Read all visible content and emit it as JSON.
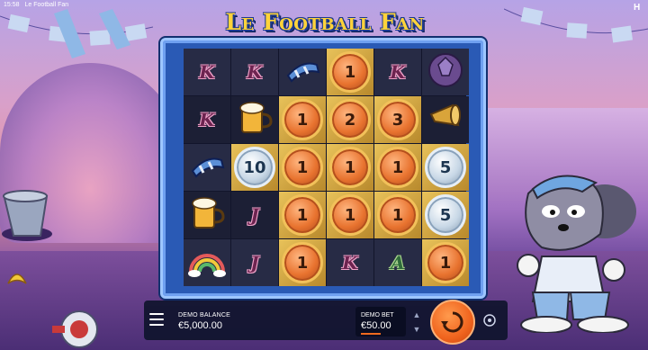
{
  "hud_top": {
    "time": "15:58",
    "title": "Le Football Fan"
  },
  "logo": {
    "text": "Le Football Fan"
  },
  "board": {
    "rows": [
      [
        {
          "type": "letter",
          "value": "K",
          "style": "pink"
        },
        {
          "type": "letter",
          "value": "K",
          "style": "pink"
        },
        {
          "type": "symbol",
          "icon": "scarf-icon"
        },
        {
          "type": "coin",
          "value": "1",
          "metal": "bronze",
          "bg": "gold"
        },
        {
          "type": "letter",
          "value": "K",
          "style": "pink"
        },
        {
          "type": "symbol",
          "icon": "football-icon"
        }
      ],
      [
        {
          "type": "letter",
          "value": "K",
          "style": "pink"
        },
        {
          "type": "symbol",
          "icon": "beer-mug-icon"
        },
        {
          "type": "coin",
          "value": "1",
          "metal": "bronze",
          "bg": "gold"
        },
        {
          "type": "coin",
          "value": "2",
          "metal": "bronze",
          "bg": "gold"
        },
        {
          "type": "coin",
          "value": "3",
          "metal": "bronze",
          "bg": "gold"
        },
        {
          "type": "symbol",
          "icon": "horn-icon"
        }
      ],
      [
        {
          "type": "symbol",
          "icon": "scarf-icon"
        },
        {
          "type": "coin",
          "value": "10",
          "metal": "silver",
          "bg": "gold"
        },
        {
          "type": "coin",
          "value": "1",
          "metal": "bronze",
          "bg": "gold"
        },
        {
          "type": "coin",
          "value": "1",
          "metal": "bronze",
          "bg": "gold"
        },
        {
          "type": "coin",
          "value": "1",
          "metal": "bronze",
          "bg": "gold"
        },
        {
          "type": "coin",
          "value": "5",
          "metal": "silver",
          "bg": "gold"
        }
      ],
      [
        {
          "type": "symbol",
          "icon": "beer-mug-icon"
        },
        {
          "type": "letter",
          "value": "J",
          "style": "pink"
        },
        {
          "type": "coin",
          "value": "1",
          "metal": "bronze",
          "bg": "gold"
        },
        {
          "type": "coin",
          "value": "1",
          "metal": "bronze",
          "bg": "gold"
        },
        {
          "type": "coin",
          "value": "1",
          "metal": "bronze",
          "bg": "gold"
        },
        {
          "type": "coin",
          "value": "5",
          "metal": "silver",
          "bg": "gold"
        }
      ],
      [
        {
          "type": "symbol",
          "icon": "rainbow-icon"
        },
        {
          "type": "letter",
          "value": "J",
          "style": "pink"
        },
        {
          "type": "coin",
          "value": "1",
          "metal": "bronze",
          "bg": "gold"
        },
        {
          "type": "letter",
          "value": "K",
          "style": "pink"
        },
        {
          "type": "letter",
          "value": "A",
          "style": "green"
        },
        {
          "type": "coin",
          "value": "1",
          "metal": "bronze",
          "bg": "gold"
        }
      ]
    ]
  },
  "controls": {
    "balance_label": "DEMO BALANCE",
    "balance_value": "€5,000.00",
    "bet_label": "DEMO BET",
    "bet_value": "€50.00"
  },
  "colors": {
    "accent": "#f0641e",
    "board_frame": "#2a5ab5",
    "logo": "#ffd33a"
  }
}
